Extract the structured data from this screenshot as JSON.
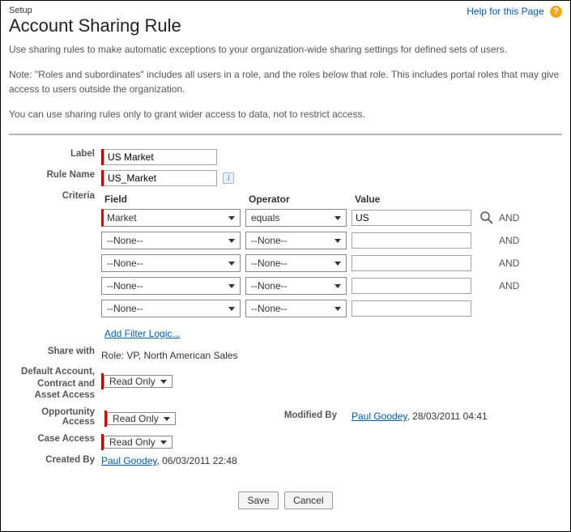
{
  "help": {
    "label": "Help for this Page"
  },
  "crumb": "Setup",
  "title": "Account Sharing Rule",
  "intro": {
    "p1": "Use sharing rules to make automatic exceptions to your organization-wide sharing settings for defined sets of users.",
    "p2": "Note: \"Roles and subordinates\" includes all users in a role, and the roles below that role. This includes portal roles that may give access to users outside the organization.",
    "p3": "You can use sharing rules only to grant wider access to data, not to restrict access."
  },
  "labels": {
    "label": "Label",
    "rule_name": "Rule Name",
    "criteria": "Criteria",
    "share_with": "Share with",
    "default_access": "Default Account, Contract and Asset Access",
    "opp_access": "Opportunity Access",
    "case_access": "Case Access",
    "created_by": "Created By",
    "modified_by": "Modified By"
  },
  "fields": {
    "label_value": "US Market",
    "rule_name_value": "US_Market",
    "share_with_value": "Role: VP, North American Sales"
  },
  "criteria": {
    "headers": {
      "field": "Field",
      "operator": "Operator",
      "value": "Value"
    },
    "rows": [
      {
        "field": "Market",
        "operator": "equals",
        "value": "US",
        "required": true,
        "lookup": true,
        "and": "AND"
      },
      {
        "field": "--None--",
        "operator": "--None--",
        "value": "",
        "and": "AND"
      },
      {
        "field": "--None--",
        "operator": "--None--",
        "value": "",
        "and": "AND"
      },
      {
        "field": "--None--",
        "operator": "--None--",
        "value": "",
        "and": "AND"
      },
      {
        "field": "--None--",
        "operator": "--None--",
        "value": ""
      }
    ],
    "add_filter": "Add Filter Logic..."
  },
  "access": {
    "default": "Read Only",
    "opportunity": "Read Only",
    "case": "Read Only"
  },
  "audit": {
    "created_by_user": "Paul Goodey",
    "created_by_ts": "06/03/2011 22:48",
    "modified_by_user": "Paul Goodey",
    "modified_by_ts": "28/03/2011 04:41"
  },
  "buttons": {
    "save": "Save",
    "cancel": "Cancel"
  }
}
